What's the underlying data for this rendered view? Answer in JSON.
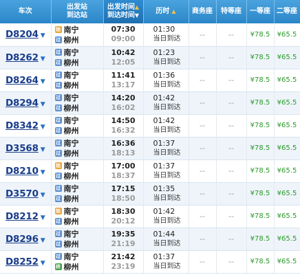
{
  "headers": {
    "train": "车次",
    "station_top": "出发站",
    "station_bottom": "到达站",
    "time_top": "出发时间",
    "time_bottom": "到达时间",
    "duration": "历时",
    "business": "商务座",
    "special": "特等座",
    "first": "一等座",
    "second": "二等座"
  },
  "colors": {
    "header_bg": "#2b86c8",
    "train_link": "#1a3d8a",
    "price": "#2a9a2a"
  },
  "rows": [
    {
      "train": "D8204",
      "from": "南宁",
      "to": "柳州",
      "from_badge": "始",
      "to_badge": "过",
      "dep": "07:30",
      "arr": "09:00",
      "dur": "01:30",
      "note": "当日到达",
      "business": "--",
      "special": "--",
      "first": "¥78.5",
      "second": "¥65.5"
    },
    {
      "train": "D8262",
      "from": "南宁",
      "to": "柳州",
      "from_badge": "过",
      "to_badge": "过",
      "dep": "10:42",
      "arr": "12:05",
      "dur": "01:23",
      "note": "当日到达",
      "business": "--",
      "special": "--",
      "first": "¥78.5",
      "second": "¥65.5"
    },
    {
      "train": "D8264",
      "from": "南宁",
      "to": "柳州",
      "from_badge": "过",
      "to_badge": "过",
      "dep": "11:41",
      "arr": "13:17",
      "dur": "01:36",
      "note": "当日到达",
      "business": "--",
      "special": "--",
      "first": "¥78.5",
      "second": "¥65.5"
    },
    {
      "train": "D8294",
      "from": "南宁",
      "to": "柳州",
      "from_badge": "过",
      "to_badge": "过",
      "dep": "14:20",
      "arr": "16:02",
      "dur": "01:42",
      "note": "当日到达",
      "business": "--",
      "special": "--",
      "first": "¥78.5",
      "second": "¥65.5"
    },
    {
      "train": "D8342",
      "from": "南宁",
      "to": "柳州",
      "from_badge": "过",
      "to_badge": "过",
      "dep": "14:50",
      "arr": "16:32",
      "dur": "01:42",
      "note": "当日到达",
      "business": "--",
      "special": "--",
      "first": "¥78.5",
      "second": "¥65.5"
    },
    {
      "train": "D3568",
      "from": "南宁",
      "to": "柳州",
      "from_badge": "过",
      "to_badge": "过",
      "dep": "16:36",
      "arr": "18:13",
      "dur": "01:37",
      "note": "当日到达",
      "business": "--",
      "special": "--",
      "first": "¥78.5",
      "second": "¥65.5"
    },
    {
      "train": "D8210",
      "from": "南宁",
      "to": "柳州",
      "from_badge": "始",
      "to_badge": "过",
      "dep": "17:00",
      "arr": "18:37",
      "dur": "01:37",
      "note": "当日到达",
      "business": "--",
      "special": "--",
      "first": "¥78.5",
      "second": "¥65.5"
    },
    {
      "train": "D3570",
      "from": "南宁",
      "to": "柳州",
      "from_badge": "过",
      "to_badge": "过",
      "dep": "17:15",
      "arr": "18:50",
      "dur": "01:35",
      "note": "当日到达",
      "business": "--",
      "special": "--",
      "first": "¥78.5",
      "second": "¥65.5"
    },
    {
      "train": "D8212",
      "from": "南宁",
      "to": "柳州",
      "from_badge": "始",
      "to_badge": "过",
      "dep": "18:30",
      "arr": "20:12",
      "dur": "01:42",
      "note": "当日到达",
      "business": "--",
      "special": "--",
      "first": "¥78.5",
      "second": "¥65.5"
    },
    {
      "train": "D8296",
      "from": "南宁",
      "to": "柳州",
      "from_badge": "过",
      "to_badge": "过",
      "dep": "19:35",
      "arr": "21:19",
      "dur": "01:44",
      "note": "当日到达",
      "business": "--",
      "special": "--",
      "first": "¥78.5",
      "second": "¥65.5"
    },
    {
      "train": "D8252",
      "from": "南宁",
      "to": "柳州",
      "from_badge": "过",
      "to_badge": "终",
      "dep": "21:42",
      "arr": "23:19",
      "dur": "01:37",
      "note": "当日到达",
      "business": "--",
      "special": "--",
      "first": "¥78.5",
      "second": "¥65.5"
    }
  ]
}
